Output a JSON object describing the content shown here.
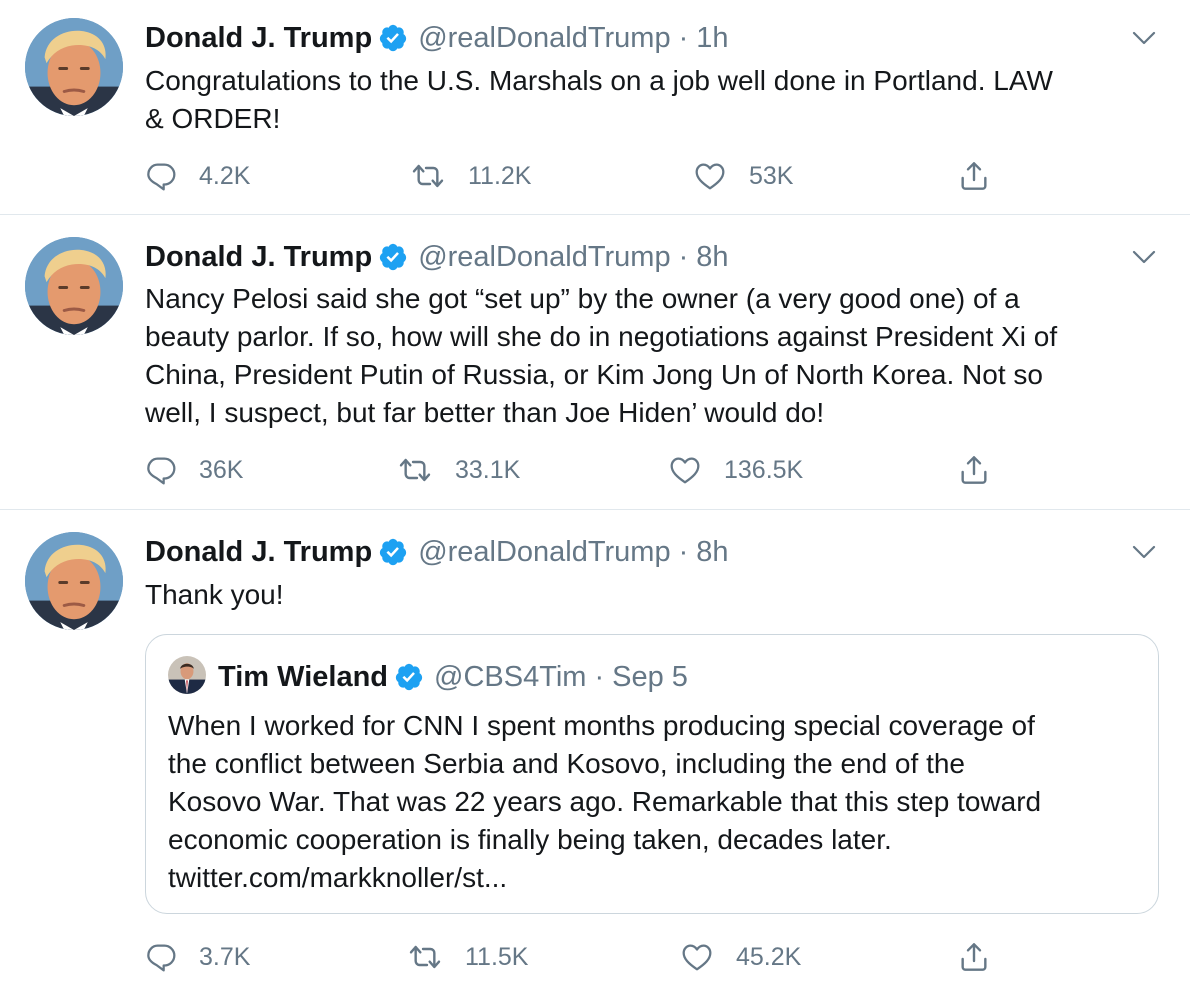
{
  "colors": {
    "verified": "#1da1f2",
    "muted": "#657786",
    "text": "#14171a",
    "divider": "#e1e8ed"
  },
  "tweets": [
    {
      "name": "Donald J. Trump",
      "handle": "@realDonaldTrump",
      "separator": "·",
      "time": "1h",
      "text": "Congratulations to the U.S. Marshals on a job well done in Portland. LAW\n& ORDER!",
      "replies": "4.2K",
      "retweets": "11.2K",
      "likes": "53K"
    },
    {
      "name": "Donald J. Trump",
      "handle": "@realDonaldTrump",
      "separator": "·",
      "time": "8h",
      "text": "Nancy Pelosi said she got “set up” by the owner (a very good one) of a\nbeauty parlor. If so, how will she do in negotiations against President Xi of\nChina, President Putin of Russia, or Kim Jong Un of North Korea. Not so\nwell, I suspect, but far better than Joe Hiden’ would do!",
      "replies": "36K",
      "retweets": "33.1K",
      "likes": "136.5K"
    },
    {
      "name": "Donald J. Trump",
      "handle": "@realDonaldTrump",
      "separator": "·",
      "time": "8h",
      "text": "Thank you!",
      "quote": {
        "name": "Tim Wieland",
        "handle": "@CBS4Tim",
        "separator": "·",
        "time": "Sep 5",
        "text": "When I worked for CNN I spent months producing special coverage of\nthe conflict between Serbia and Kosovo, including the end of the\nKosovo War. That was 22 years ago. Remarkable that this step toward\neconomic cooperation is finally being taken, decades later.\ntwitter.com/markknoller/st..."
      },
      "replies": "3.7K",
      "retweets": "11.5K",
      "likes": "45.2K"
    }
  ]
}
